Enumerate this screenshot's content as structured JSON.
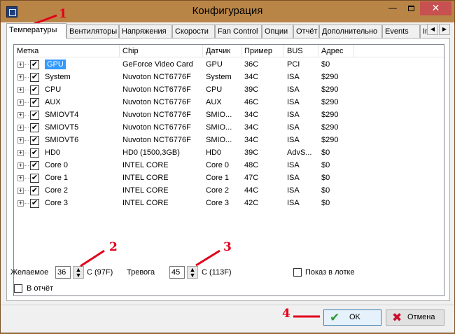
{
  "window": {
    "title": "Конфигурация",
    "min_glyph": "—",
    "close_glyph": "✕"
  },
  "tabs": [
    {
      "label": "Температуры",
      "active": true
    },
    {
      "label": "Вентиляторы",
      "active": false
    },
    {
      "label": "Напряжения",
      "active": false
    },
    {
      "label": "Скорости",
      "active": false
    },
    {
      "label": "Fan Control",
      "active": false
    },
    {
      "label": "Опции",
      "active": false
    },
    {
      "label": "Отчёт",
      "active": false
    },
    {
      "label": "Дополнительно",
      "active": false
    },
    {
      "label": "Events",
      "active": false
    },
    {
      "label": "In",
      "active": false
    }
  ],
  "tab_scroll": {
    "left": "◀",
    "right": "▶"
  },
  "sensors": {
    "columns": [
      "Метка",
      "Chip",
      "Датчик",
      "Пример",
      "BUS",
      "Адрес"
    ],
    "rows": [
      {
        "label": "GPU",
        "chip": "GeForce Video Card",
        "sensor": "GPU",
        "sample": "36C",
        "bus": "PCI",
        "address": "$0",
        "checked": true,
        "selected": true
      },
      {
        "label": "System",
        "chip": "Nuvoton NCT6776F",
        "sensor": "System",
        "sample": "34C",
        "bus": "ISA",
        "address": "$290",
        "checked": true,
        "selected": false
      },
      {
        "label": "CPU",
        "chip": "Nuvoton NCT6776F",
        "sensor": "CPU",
        "sample": "39C",
        "bus": "ISA",
        "address": "$290",
        "checked": true,
        "selected": false
      },
      {
        "label": "AUX",
        "chip": "Nuvoton NCT6776F",
        "sensor": "AUX",
        "sample": "46C",
        "bus": "ISA",
        "address": "$290",
        "checked": true,
        "selected": false
      },
      {
        "label": "SMIOVT4",
        "chip": "Nuvoton NCT6776F",
        "sensor": "SMIO...",
        "sample": "34C",
        "bus": "ISA",
        "address": "$290",
        "checked": true,
        "selected": false
      },
      {
        "label": "SMIOVT5",
        "chip": "Nuvoton NCT6776F",
        "sensor": "SMIO...",
        "sample": "34C",
        "bus": "ISA",
        "address": "$290",
        "checked": true,
        "selected": false
      },
      {
        "label": "SMIOVT6",
        "chip": "Nuvoton NCT6776F",
        "sensor": "SMIO...",
        "sample": "34C",
        "bus": "ISA",
        "address": "$290",
        "checked": true,
        "selected": false
      },
      {
        "label": "HD0",
        "chip": "HD0 (1500,3GB)",
        "sensor": "HD0",
        "sample": "39C",
        "bus": "AdvS...",
        "address": "$0",
        "checked": true,
        "selected": false
      },
      {
        "label": "Core 0",
        "chip": "INTEL CORE",
        "sensor": "Core 0",
        "sample": "48C",
        "bus": "ISA",
        "address": "$0",
        "checked": true,
        "selected": false
      },
      {
        "label": "Core 1",
        "chip": "INTEL CORE",
        "sensor": "Core 1",
        "sample": "47C",
        "bus": "ISA",
        "address": "$0",
        "checked": true,
        "selected": false
      },
      {
        "label": "Core 2",
        "chip": "INTEL CORE",
        "sensor": "Core 2",
        "sample": "44C",
        "bus": "ISA",
        "address": "$0",
        "checked": true,
        "selected": false
      },
      {
        "label": "Core 3",
        "chip": "INTEL CORE",
        "sensor": "Core 3",
        "sample": "42C",
        "bus": "ISA",
        "address": "$0",
        "checked": true,
        "selected": false
      }
    ]
  },
  "settings": {
    "desired_label": "Желаемое",
    "desired_value": "36",
    "desired_unit": "C (97F)",
    "alarm_label": "Тревога",
    "alarm_value": "45",
    "alarm_unit": "C (113F)",
    "tray_label": "Показ в лотке",
    "tray_checked": false,
    "report_label": "В отчёт",
    "report_checked": false
  },
  "buttons": {
    "ok_label": "OK",
    "cancel_label": "Отмена"
  },
  "annotations": [
    "1",
    "2",
    "3",
    "4"
  ],
  "colors": {
    "titlebar": "#b98547",
    "selection": "#3399ff",
    "annotation": "#e3001b",
    "ok_icon": "#2e9a2e",
    "cancel_icon": "#c8102e"
  }
}
